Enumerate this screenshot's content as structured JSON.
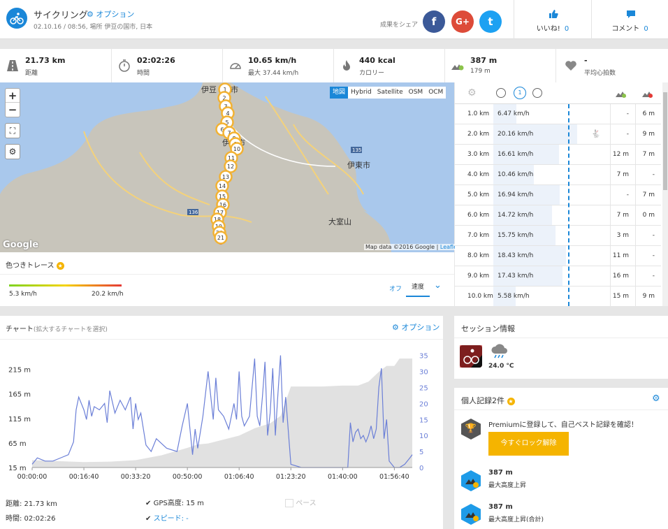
{
  "header": {
    "title": "サイクリング",
    "options_label": "オプション",
    "subtitle": "02.10.16 / 08:56, 場所 伊豆の国市, 日本",
    "share_label": "成果をシェア",
    "social": [
      "f",
      "G+",
      "t"
    ],
    "like_label": "いいね!",
    "like_count": "0",
    "comment_label": "コメント",
    "comment_count": "0"
  },
  "stats": [
    {
      "icon": "road-icon",
      "value": "21.73 km",
      "label": "距離"
    },
    {
      "icon": "stopwatch-icon",
      "value": "02:02:26",
      "label": "時間"
    },
    {
      "icon": "speedometer-icon",
      "value": "10.65 km/h",
      "label": "最大 37.44 km/h"
    },
    {
      "icon": "flame-icon",
      "value": "440 kcal",
      "label": "カロリー"
    },
    {
      "icon": "elevation-up-icon",
      "value": "387 m",
      "label": "179 m"
    },
    {
      "icon": "heart-icon",
      "value": "-",
      "label": "平均心拍数"
    }
  ],
  "map": {
    "layers": [
      "地図",
      "Hybrid",
      "Satellite",
      "OSM",
      "OCM"
    ],
    "active_layer": "地図",
    "zoom_in": "+",
    "zoom_out": "−",
    "attribution": "Map data ©2016 Google",
    "leaflet": "Leaflet",
    "google": "Google",
    "labels": [
      "伊豆の国市",
      "伊東市",
      "大室山",
      "伊豆市",
      "136",
      "135",
      "138"
    ],
    "markers": [
      "1",
      "2",
      "3",
      "4",
      "5",
      "6",
      "7",
      "8",
      "9",
      "10",
      "11",
      "12",
      "13",
      "14",
      "15",
      "16",
      "17",
      "18",
      "19",
      "20",
      "21"
    ]
  },
  "trace": {
    "title": "色つきトレース",
    "min_label": "5.3 km/h",
    "max_label": "20.2 km/h",
    "off_label": "オフ",
    "speed_label": "速度"
  },
  "splits": [
    {
      "km": "1.0 km",
      "speed": "6.47 km/h",
      "frac": 0.2,
      "up": "-",
      "down": "6 m"
    },
    {
      "km": "2.0 km",
      "speed": "20.16 km/h",
      "frac": 0.72,
      "up": "-",
      "down": "9 m"
    },
    {
      "km": "3.0 km",
      "speed": "16.61 km/h",
      "frac": 0.56,
      "up": "12 m",
      "down": "7 m"
    },
    {
      "km": "4.0 km",
      "speed": "10.46 km/h",
      "frac": 0.35,
      "up": "7 m",
      "down": "-"
    },
    {
      "km": "5.0 km",
      "speed": "16.94 km/h",
      "frac": 0.57,
      "up": "-",
      "down": "7 m"
    },
    {
      "km": "6.0 km",
      "speed": "14.72 km/h",
      "frac": 0.5,
      "up": "7 m",
      "down": "0 m"
    },
    {
      "km": "7.0 km",
      "speed": "15.75 km/h",
      "frac": 0.53,
      "up": "3 m",
      "down": "-"
    },
    {
      "km": "8.0 km",
      "speed": "18.43 km/h",
      "frac": 0.62,
      "up": "11 m",
      "down": "-"
    },
    {
      "km": "9.0 km",
      "speed": "17.43 km/h",
      "frac": 0.59,
      "up": "16 m",
      "down": "-"
    },
    {
      "km": "10.0 km",
      "speed": "5.58 km/h",
      "frac": 0.19,
      "up": "15 m",
      "down": "9 m"
    }
  ],
  "chart_panel": {
    "title": "チャート",
    "hint": "(拡大するチャートを選択)",
    "options_label": "オプション",
    "distance_label": "距離: 21.73 km",
    "time_label": "時間: 02:02:26",
    "gps_label": "GPS高度: 15 m",
    "speed_label": "スピード: -",
    "pace_label": "ペース"
  },
  "chart_data": {
    "type": "line",
    "x_ticks": [
      "00:00:00",
      "00:16:40",
      "00:33:20",
      "00:50:00",
      "01:06:40",
      "01:23:20",
      "01:40:00",
      "01:56:40"
    ],
    "x_tick_seconds": [
      0,
      1000,
      2000,
      3000,
      4000,
      5000,
      6000,
      7000
    ],
    "xlim": [
      0,
      7346
    ],
    "y_ticks": [
      "215 m",
      "165 m",
      "115 m",
      "65 m",
      "15 m"
    ],
    "ylim": [
      15,
      250
    ],
    "y2_ticks": [
      "35",
      "30",
      "25",
      "20",
      "15",
      "10",
      "5",
      "0"
    ],
    "y2lim": [
      0,
      36
    ],
    "series": [
      {
        "kind": "area",
        "color": "#e1e1e1",
        "x": [
          0,
          500,
          1000,
          1500,
          2000,
          2500,
          3000,
          3200,
          3400,
          3700,
          4000,
          4300,
          4600,
          4800,
          5000,
          5300,
          5600,
          6000,
          6300,
          6500,
          6700,
          6850,
          7000,
          7100,
          7346
        ],
        "y": [
          30,
          28,
          26,
          27,
          30,
          40,
          55,
          62,
          64,
          72,
          80,
          95,
          105,
          120,
          180,
          180,
          180,
          182,
          182,
          190,
          210,
          222,
          222,
          237,
          237
        ]
      },
      {
        "kind": "line",
        "color": "#6b7fd7",
        "x": [
          0,
          100,
          250,
          400,
          550,
          700,
          800,
          850,
          900,
          950,
          1000,
          1050,
          1100,
          1150,
          1200,
          1300,
          1400,
          1450,
          1500,
          1600,
          1700,
          1800,
          1900,
          1950,
          2000,
          2050,
          2100,
          2200,
          2300,
          2400,
          2600,
          2800,
          2900,
          3000,
          3100,
          3150,
          3200,
          3300,
          3400,
          3500,
          3550,
          3600,
          3700,
          3800,
          3900,
          3950,
          4000,
          4050,
          4100,
          4200,
          4300,
          4350,
          4400,
          4450,
          4500,
          4550,
          4600,
          4650,
          4700,
          4750,
          4800,
          4850,
          4900,
          5000,
          5200,
          5400,
          5600,
          5800,
          6000,
          6100,
          6150,
          6200,
          6250,
          6300,
          6350,
          6400,
          6450,
          6500,
          6550,
          6600,
          6650,
          6700,
          6750,
          6800,
          6850,
          6900,
          7000,
          7100,
          7200,
          7300,
          7346
        ],
        "y": [
          1,
          3,
          2,
          2,
          3,
          4,
          8,
          18,
          22,
          20,
          18,
          15,
          21,
          16,
          19,
          18,
          20,
          14,
          24,
          17,
          21,
          18,
          22,
          12,
          20,
          15,
          17,
          7,
          5,
          9,
          6,
          5,
          13,
          20,
          4,
          12,
          6,
          16,
          30,
          15,
          28,
          18,
          16,
          12,
          20,
          15,
          30,
          16,
          13,
          16,
          34,
          16,
          13,
          22,
          33,
          10,
          17,
          31,
          10,
          23,
          35,
          14,
          22,
          1,
          0,
          0,
          0,
          0,
          0,
          0,
          14,
          8,
          11,
          12,
          9,
          10,
          8,
          10,
          13,
          9,
          12,
          25,
          31,
          9,
          15,
          2,
          0,
          0,
          1,
          3,
          4
        ]
      }
    ]
  },
  "session": {
    "title": "セッション情報",
    "weather": "24.0 °C"
  },
  "records": {
    "title": "個人記録2件",
    "promo": "Premiumに登録して、自己ベスト記録を確認！",
    "unlock": "今すぐロック解除",
    "items": [
      {
        "value": "387 m",
        "label": "最大高度上昇"
      },
      {
        "value": "387 m",
        "label": "最大高度上昇(合計)"
      }
    ]
  }
}
